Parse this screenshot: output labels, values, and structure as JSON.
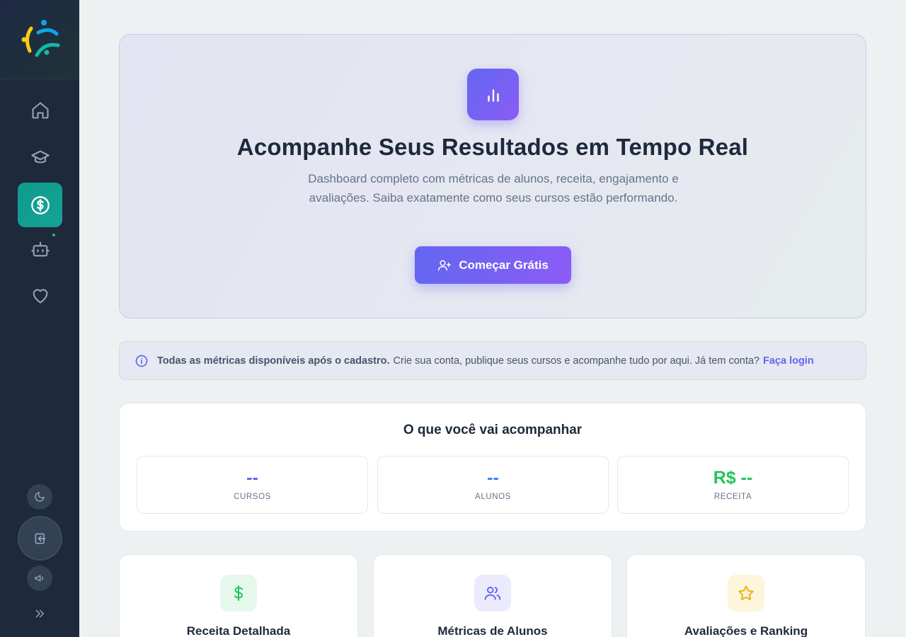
{
  "sidebar": {
    "logo_icon": "brand-logo",
    "items": [
      {
        "name": "home",
        "icon": "home-icon"
      },
      {
        "name": "courses",
        "icon": "graduation-cap-icon"
      },
      {
        "name": "revenue",
        "icon": "dollar-circle-icon",
        "active": true
      },
      {
        "name": "bot",
        "icon": "bot-icon"
      },
      {
        "name": "favorites",
        "icon": "heart-icon"
      }
    ],
    "bottom": [
      {
        "name": "theme",
        "icon": "moon-icon"
      },
      {
        "name": "login",
        "icon": "login-icon"
      },
      {
        "name": "announcements",
        "icon": "megaphone-icon"
      },
      {
        "name": "expand",
        "icon": "chevrons-right-icon"
      }
    ]
  },
  "hero": {
    "icon": "bar-chart-icon",
    "title": "Acompanhe Seus Resultados em Tempo Real",
    "subtitle": "Dashboard completo com métricas de alunos, receita, engajamento e avaliações. Saiba exatamente como seus cursos estão performando.",
    "cta_label": "Começar Grátis",
    "cta_icon": "user-plus-icon"
  },
  "info": {
    "icon": "info-icon",
    "strong": "Todas as métricas disponíveis após o cadastro.",
    "text": "Crie sua conta, publique seus cursos e acompanhe tudo por aqui. Já tem conta?",
    "link": "Faça login"
  },
  "metrics": {
    "title": "O que você vai acompanhar",
    "items": [
      {
        "value": "--",
        "label": "CURSOS",
        "color": "#6366f1"
      },
      {
        "value": "--",
        "label": "ALUNOS",
        "color": "#3b82f6"
      },
      {
        "value": "R$ --",
        "label": "RECEITA",
        "color": "#22c55e"
      }
    ]
  },
  "features": [
    {
      "title": "Receita Detalhada",
      "icon": "dollar-icon",
      "color": "#22c55e",
      "bg": "#e6f8ec"
    },
    {
      "title": "Métricas de Alunos",
      "icon": "users-icon",
      "color": "#6366f1",
      "bg": "#ecebfd"
    },
    {
      "title": "Avaliações e Ranking",
      "icon": "star-icon",
      "color": "#eab308",
      "bg": "#fdf5dc"
    }
  ]
}
